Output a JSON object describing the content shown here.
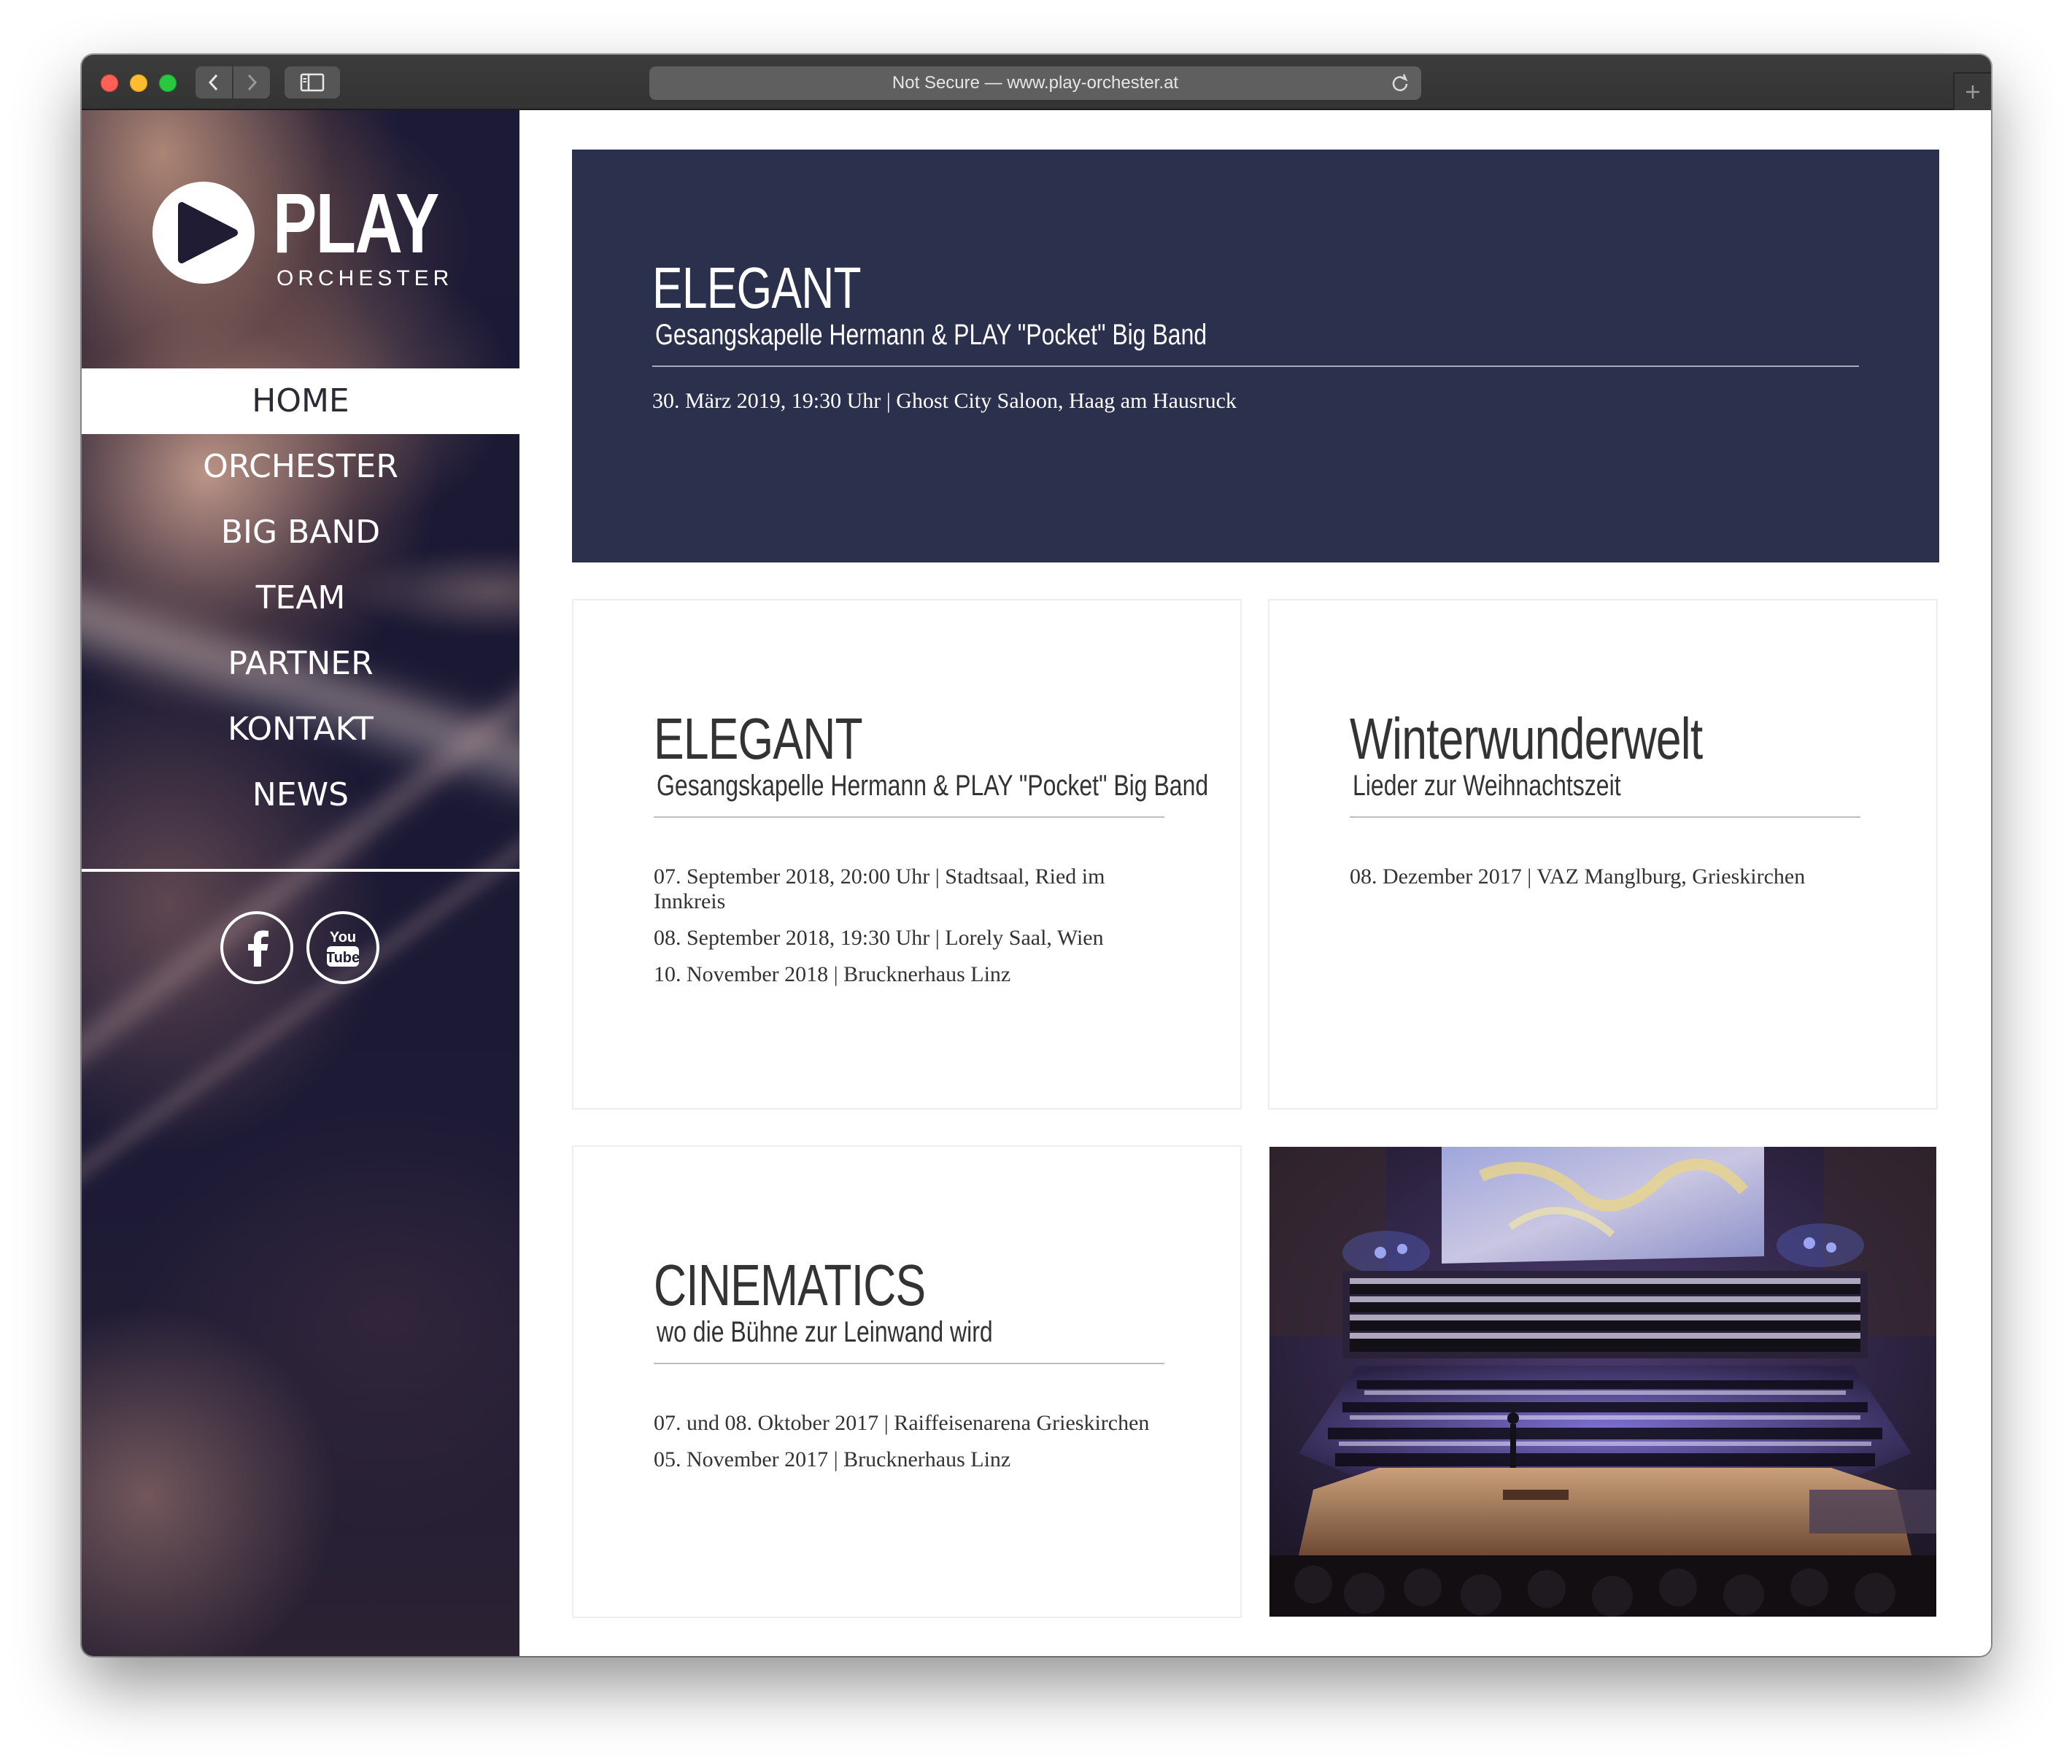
{
  "browser": {
    "url_text": "Not Secure — www.play-orchester.at"
  },
  "logo": {
    "word": "PLAY",
    "sub": "ORCHESTER"
  },
  "nav": {
    "items": [
      {
        "label": "HOME",
        "active": true
      },
      {
        "label": "ORCHESTER"
      },
      {
        "label": "BIG BAND"
      },
      {
        "label": "TEAM"
      },
      {
        "label": "PARTNER"
      },
      {
        "label": "KONTAKT"
      },
      {
        "label": "NEWS"
      }
    ]
  },
  "social": {
    "facebook_icon": "facebook-icon",
    "youtube_icon": "youtube-icon"
  },
  "hero": {
    "title": "ELEGANT",
    "subtitle": "Gesangskapelle Hermann & PLAY \"Pocket\" Big Band",
    "dates": [
      "30. März 2019, 19:30 Uhr | Ghost City Saloon, Haag am Hausruck"
    ]
  },
  "cards": [
    {
      "title": "ELEGANT",
      "subtitle": "Gesangskapelle Hermann & PLAY \"Pocket\" Big Band",
      "dates": [
        "07. September 2018, 20:00 Uhr | Stadtsaal, Ried im Innkreis",
        "08. September 2018, 19:30 Uhr | Lorely Saal, Wien",
        "10. November 2018 | Brucknerhaus Linz"
      ]
    },
    {
      "title": "Winterwunderwelt",
      "subtitle": "Lieder zur Weihnachtszeit",
      "dates": [
        "08. Dezember 2017 | VAZ Manglburg, Grieskirchen"
      ]
    },
    {
      "title": "CINEMATICS",
      "subtitle": "wo die Bühne zur Leinwand wird",
      "dates": [
        "07. und 08. Oktober 2017 | Raiffeisenarena Grieskirchen",
        "05. November 2017 | Brucknerhaus Linz"
      ]
    }
  ],
  "colors": {
    "hero_bg": "#2b304c",
    "sidebar_bg": "#1c1a36",
    "text": "#333333"
  }
}
